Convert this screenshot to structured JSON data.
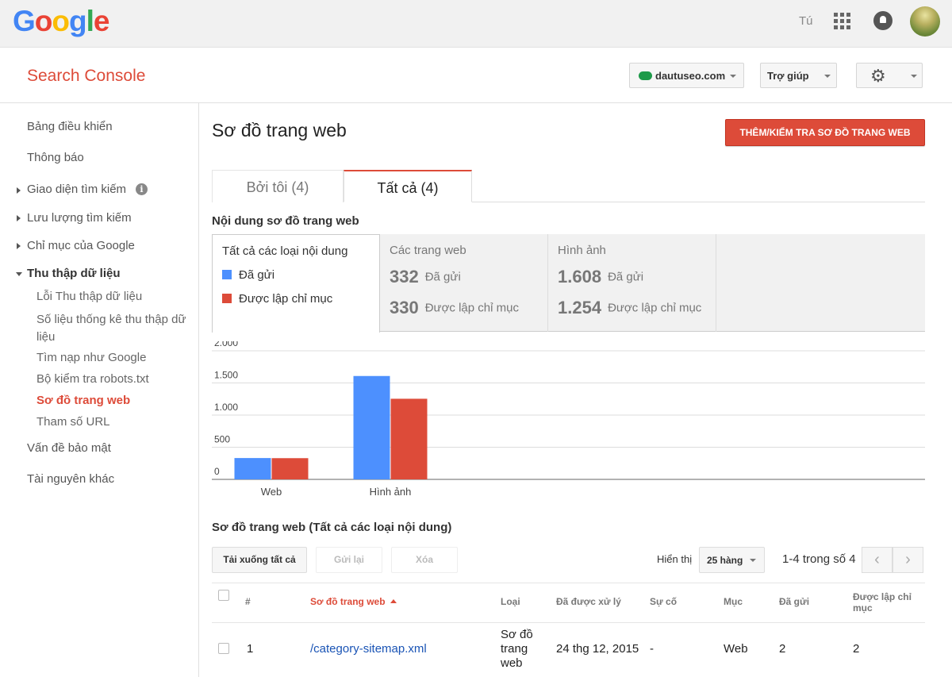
{
  "topbar": {
    "logo_letters": [
      {
        "ch": "G",
        "color": "#4285F4"
      },
      {
        "ch": "o",
        "color": "#EA4335"
      },
      {
        "ch": "o",
        "color": "#FBBC05"
      },
      {
        "ch": "g",
        "color": "#4285F4"
      },
      {
        "ch": "l",
        "color": "#34A853"
      },
      {
        "ch": "e",
        "color": "#EA4335"
      }
    ],
    "user_name": "Tú"
  },
  "header": {
    "product_name": "Search Console",
    "site": "dautuseo.com",
    "help_label": "Trợ giúp"
  },
  "sidebar": {
    "items": [
      {
        "label": "Bảng điều khiển"
      },
      {
        "label": "Thông báo"
      },
      {
        "label": "Giao diện tìm kiếm"
      },
      {
        "label": "Lưu lượng tìm kiếm"
      },
      {
        "label": "Chỉ mục của Google"
      },
      {
        "label": "Thu thập dữ liệu"
      },
      {
        "label": "Lỗi Thu thập dữ liệu"
      },
      {
        "label": "Số liệu thống kê thu thập dữ liệu"
      },
      {
        "label": "Tìm nạp như Google"
      },
      {
        "label": "Bộ kiểm tra robots.txt"
      },
      {
        "label": "Sơ đồ trang web"
      },
      {
        "label": "Tham số URL"
      },
      {
        "label": "Vấn đề bảo mật"
      },
      {
        "label": "Tài nguyên khác"
      }
    ]
  },
  "main": {
    "title": "Sơ đồ trang web",
    "add_button": "THÊM/KIỂM TRA SƠ ĐỒ TRANG WEB",
    "tabs": [
      {
        "label": "Bởi tôi (4)"
      },
      {
        "label": "Tất cả (4)"
      }
    ],
    "content_heading": "Nội dung sơ đồ trang web",
    "colors": {
      "submitted": "#4d90fe",
      "indexed": "#dd4b39"
    },
    "stats": {
      "all": {
        "title": "Tất cả các loại nội dung",
        "legend_submitted": "Đã gửi",
        "legend_indexed": "Được lập chỉ mục"
      },
      "web": {
        "title": "Các trang web",
        "submitted_value": "332",
        "submitted_label": "Đã gửi",
        "indexed_value": "330",
        "indexed_label": "Được lập chỉ mục"
      },
      "images": {
        "title": "Hình ảnh",
        "submitted_value": "1.608",
        "submitted_label": "Đã gửi",
        "indexed_value": "1.254",
        "indexed_label": "Được lập chỉ mục"
      }
    },
    "table_heading": "Sơ đồ trang web (Tất cả các loại nội dung)",
    "toolbar": {
      "download_all": "Tải xuống tất cả",
      "resubmit": "Gửi lại",
      "delete": "Xóa",
      "show_label": "Hiển thị",
      "rows_value": "25 hàng",
      "range": "1-4 trong số 4",
      "prev": "‹",
      "next": "›"
    },
    "table": {
      "headers": {
        "num": "#",
        "sitemap": "Sơ đồ trang web",
        "type": "Loại",
        "processed": "Đã được xử lý",
        "issues": "Sự cố",
        "items": "Mục",
        "submitted": "Đã gửi",
        "indexed": "Được lập chỉ mục"
      },
      "rows": [
        {
          "num": "1",
          "sitemap": "/category-sitemap.xml",
          "type": "Sơ đồ trang web",
          "processed": "24 thg 12, 2015",
          "issues": "-",
          "items": "Web",
          "submitted": "2",
          "indexed": "2"
        }
      ]
    }
  },
  "chart_data": {
    "type": "bar",
    "categories": [
      "Web",
      "Hình ảnh"
    ],
    "category_labels": [
      "Web",
      "Hình ảnh"
    ],
    "series": [
      {
        "key": "submitted",
        "values": [
          332,
          1608
        ],
        "color": "#4d90fe"
      },
      {
        "key": "indexed",
        "values": [
          330,
          1254
        ],
        "color": "#dd4b39"
      }
    ],
    "ylim": [
      0,
      2000
    ],
    "y_ticks": [
      0,
      500,
      1000,
      1500,
      2000
    ],
    "y_tick_labels": [
      "0",
      "500",
      "1.000",
      "1.500",
      "2.000"
    ],
    "grid": true
  }
}
